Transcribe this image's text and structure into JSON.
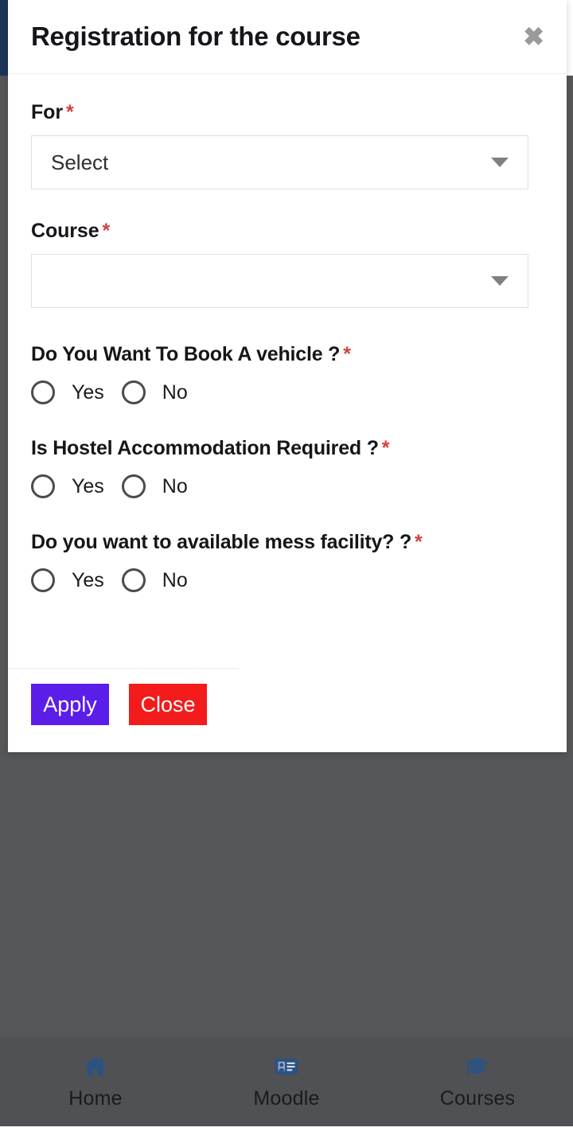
{
  "modal": {
    "title": "Registration for the course",
    "close_icon": "close-x-icon",
    "fields": [
      {
        "label": "For",
        "required_marker": "*",
        "value": "Select",
        "caret_icon": "chevron-down-icon"
      },
      {
        "label": "Course",
        "required_marker": "*",
        "value": "",
        "caret_icon": "chevron-down-icon"
      }
    ],
    "questions": [
      {
        "text": "Do You Want To Book A vehicle ?",
        "required_marker": "*",
        "options": [
          "Yes",
          "No"
        ],
        "selected": null
      },
      {
        "text": "Is Hostel Accommodation Required ?",
        "required_marker": "*",
        "options": [
          "Yes",
          "No"
        ],
        "selected": null
      },
      {
        "text": "Do you want to available mess facility? ?",
        "required_marker": "*",
        "options": [
          "Yes",
          "No"
        ],
        "selected": null
      }
    ],
    "footer": {
      "apply_label": "Apply",
      "close_label": "Close",
      "apply_color": "#5b1ee8",
      "close_color": "#f31b1b"
    }
  },
  "bottom_nav": {
    "items": [
      {
        "label": "Home",
        "icon": "home-icon"
      },
      {
        "label": "Moodle",
        "icon": "id-card-icon"
      },
      {
        "label": "Courses",
        "icon": "graduation-cap-icon"
      }
    ],
    "icon_color": "#2c5282",
    "background_color": "#4f5155"
  },
  "overlay": {
    "scrim_color": "#565759",
    "accent_strip_color": "#1c3557"
  }
}
